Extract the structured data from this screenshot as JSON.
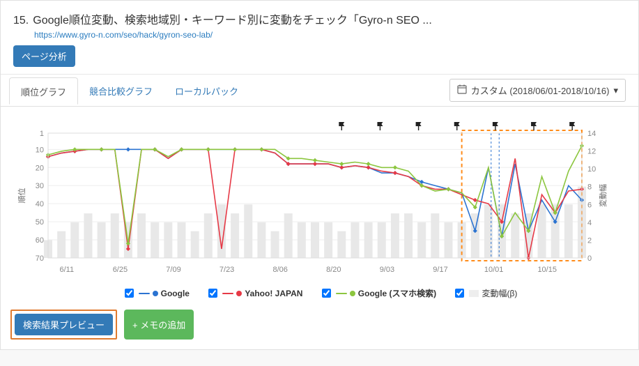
{
  "header": {
    "rank_num": "15.",
    "title": "Google順位変動、検索地域別・キーワード別に変動をチェック「Gyro-n SEO ...",
    "url": "https://www.gyro-n.com/seo/hack/gyron-seo-lab/",
    "page_analyze_label": "ページ分析"
  },
  "tabs": {
    "ranking": "順位グラフ",
    "compare": "競合比較グラフ",
    "localpack": "ローカルパック"
  },
  "range_picker": {
    "icon": "calendar-icon",
    "label": "カスタム (2018/06/01-2018/10/16)",
    "caret": "▾"
  },
  "axes": {
    "y_left_label": "順位",
    "y_right_label": "変動幅"
  },
  "legend": {
    "google": "Google",
    "yahoo": "Yahoo! JAPAN",
    "google_sp": "Google (スマホ検索)",
    "volatility": "変動幅(β)"
  },
  "colors": {
    "google": "#2b73d1",
    "yahoo": "#e63946",
    "google_sp": "#8cc63f",
    "volatility": "#e8e8e8",
    "highlight_box": "#ff8c1a"
  },
  "actions": {
    "preview": "検索結果プレビュー",
    "memo": "メモの追加"
  },
  "chart_data": {
    "type": "line",
    "xlabel": "",
    "ylabel_left": "順位",
    "ylabel_right": "変動幅",
    "ylim_left": [
      70,
      1
    ],
    "ylim_right": [
      0,
      14
    ],
    "y_left_ticks": [
      1,
      10,
      20,
      30,
      40,
      50,
      60,
      70
    ],
    "y_right_ticks": [
      0,
      2,
      4,
      6,
      8,
      10,
      12,
      14
    ],
    "categories": [
      "6/11",
      "6/25",
      "7/09",
      "7/23",
      "8/06",
      "8/20",
      "9/03",
      "9/17",
      "10/01",
      "10/15"
    ],
    "pin_flags_x": [
      "8/24",
      "9/03",
      "9/13",
      "9/27",
      "10/03",
      "10/08",
      "10/15"
    ],
    "highlight_range": {
      "start": "9/24",
      "end": "10/16"
    },
    "series": [
      {
        "name": "Google",
        "axis": "left",
        "color": "#2b73d1",
        "style": "line-diamond",
        "values": [
          14,
          12,
          11,
          10,
          10,
          10,
          10,
          10,
          10,
          15,
          10,
          10,
          10,
          10,
          10,
          10,
          10,
          12,
          18,
          18,
          18,
          18,
          20,
          19,
          20,
          23,
          23,
          25,
          28,
          30,
          32,
          34,
          55,
          20,
          58,
          18,
          55,
          38,
          50,
          30,
          38
        ]
      },
      {
        "name": "Yahoo! JAPAN",
        "axis": "left",
        "color": "#e63946",
        "style": "line-diamond",
        "values": [
          14,
          12,
          11,
          10,
          10,
          10,
          65,
          10,
          10,
          15,
          10,
          10,
          10,
          65,
          10,
          10,
          10,
          12,
          18,
          18,
          18,
          18,
          20,
          19,
          20,
          22,
          23,
          25,
          30,
          32,
          32,
          35,
          38,
          40,
          50,
          15,
          70,
          35,
          45,
          33,
          32
        ]
      },
      {
        "name": "Google (スマホ検索)",
        "axis": "left",
        "color": "#8cc63f",
        "style": "line-diamond",
        "values": [
          13,
          11,
          10,
          10,
          10,
          10,
          62,
          10,
          10,
          14,
          10,
          10,
          10,
          10,
          10,
          10,
          10,
          10,
          15,
          15,
          16,
          17,
          18,
          17,
          18,
          20,
          20,
          22,
          30,
          33,
          32,
          34,
          42,
          20,
          58,
          45,
          55,
          25,
          45,
          22,
          8
        ]
      },
      {
        "name": "変動幅(β)",
        "axis": "right",
        "color": "#e8e8e8",
        "style": "bar",
        "values": [
          2,
          3,
          4,
          5,
          4,
          5,
          4,
          5,
          4,
          4,
          4,
          3,
          5,
          6,
          5,
          6,
          4,
          3,
          5,
          4,
          4,
          4,
          3,
          4,
          4,
          4,
          5,
          5,
          4,
          5,
          4,
          4,
          5,
          6,
          6,
          5,
          5,
          6,
          6,
          6,
          8
        ]
      }
    ]
  }
}
